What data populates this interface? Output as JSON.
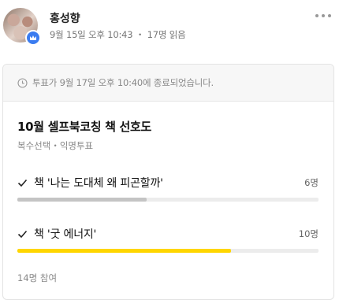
{
  "post": {
    "author": "홍성향",
    "date": "9월 15일 오후 10:43",
    "separator": "・",
    "reads": "17명 읽음"
  },
  "poll": {
    "notice": "투표가 9월 17일 오후 10:40에 종료되었습니다.",
    "title": "10월 셀프북코칭 책 선호도",
    "subtitle": "복수선택・익명투표",
    "participants": "14명 참여",
    "options": [
      {
        "label": "책 '나는 도대체 왜 피곤할까'",
        "count": "6명",
        "fraction": 0.43,
        "color": "#c4c4c4"
      },
      {
        "label": "책 '굿 에너지'",
        "count": "10명",
        "fraction": 0.71,
        "color": "#ffd600"
      }
    ]
  },
  "icons": {
    "more": "more-dots-icon",
    "clock": "clock-icon",
    "check": "check-icon",
    "badge": "crown-badge-icon"
  }
}
